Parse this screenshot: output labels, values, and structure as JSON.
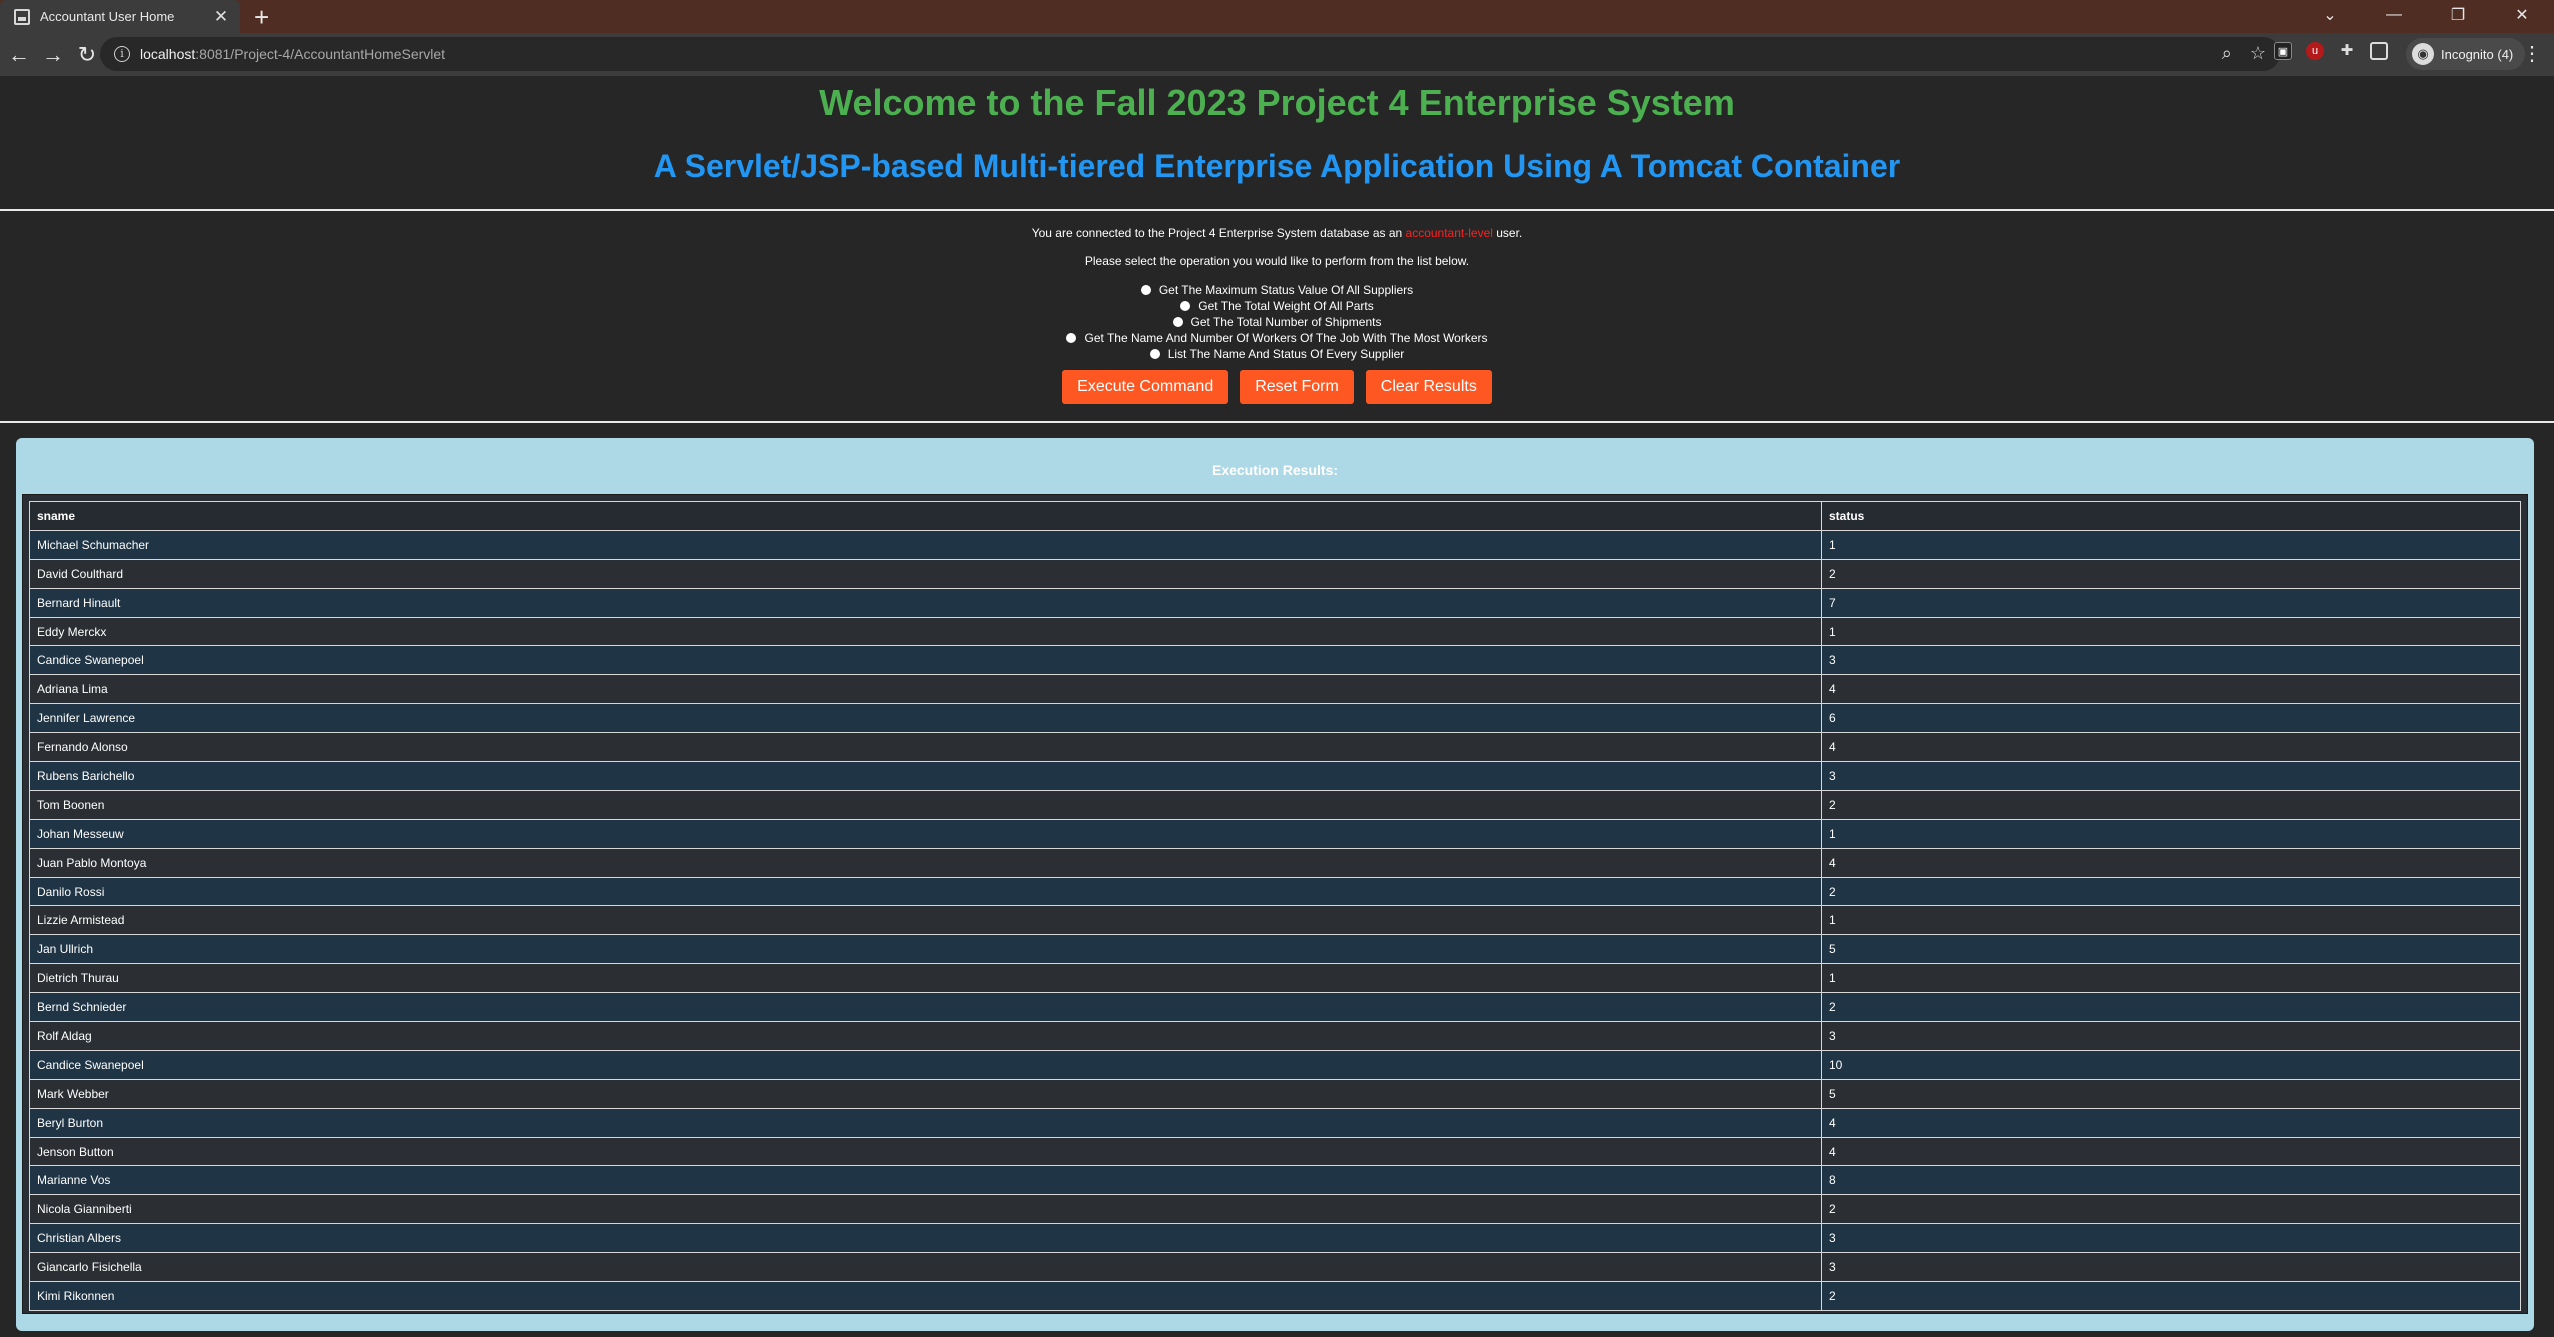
{
  "browser": {
    "tab_title": "Accountant User Home",
    "url_host": "localhost",
    "url_rest": ":8081/Project-4/AccountantHomeServlet",
    "profile_label": "Incognito (4)"
  },
  "page": {
    "title": "Welcome to the Fall 2023 Project 4 Enterprise System",
    "subtitle": "A Servlet/JSP-based Multi-tiered Enterprise Application Using A Tomcat Container",
    "connected_prefix": "You are connected to the Project 4 Enterprise System database as an ",
    "connected_level": "accountant-level",
    "connected_suffix": " user.",
    "instruction": "Please select the operation you would like to perform from the list below.",
    "options": [
      "Get The Maximum Status Value Of All Suppliers",
      "Get The Total Weight Of All Parts",
      "Get The Total Number of Shipments",
      "Get The Name And Number Of Workers Of The Job With The Most Workers",
      "List The Name And Status Of Every Supplier"
    ],
    "buttons": {
      "execute": "Execute Command",
      "reset": "Reset Form",
      "clear": "Clear Results"
    },
    "results_title": "Execution Results:"
  },
  "results": {
    "columns": [
      "sname",
      "status"
    ],
    "rows": [
      [
        "Michael Schumacher",
        "1"
      ],
      [
        "David Coulthard",
        "2"
      ],
      [
        "Bernard Hinault",
        "7"
      ],
      [
        "Eddy Merckx",
        "1"
      ],
      [
        "Candice Swanepoel",
        "3"
      ],
      [
        "Adriana Lima",
        "4"
      ],
      [
        "Jennifer Lawrence",
        "6"
      ],
      [
        "Fernando Alonso",
        "4"
      ],
      [
        "Rubens Barichello",
        "3"
      ],
      [
        "Tom Boonen",
        "2"
      ],
      [
        "Johan Messeuw",
        "1"
      ],
      [
        "Juan Pablo Montoya",
        "4"
      ],
      [
        "Danilo Rossi",
        "2"
      ],
      [
        "Lizzie Armistead",
        "1"
      ],
      [
        "Jan Ullrich",
        "5"
      ],
      [
        "Dietrich Thurau",
        "1"
      ],
      [
        "Bernd Schnieder",
        "2"
      ],
      [
        "Rolf Aldag",
        "3"
      ],
      [
        "Candice Swanepoel",
        "10"
      ],
      [
        "Mark Webber",
        "5"
      ],
      [
        "Beryl Burton",
        "4"
      ],
      [
        "Jenson Button",
        "4"
      ],
      [
        "Marianne Vos",
        "8"
      ],
      [
        "Nicola Gianniberti",
        "2"
      ],
      [
        "Christian Albers",
        "3"
      ],
      [
        "Giancarlo Fisichella",
        "3"
      ],
      [
        "Kimi Rikonnen",
        "2"
      ]
    ]
  },
  "colors": {
    "title": "#4caf50",
    "subtitle": "#2196f3",
    "button": "#ff5722",
    "level_text": "#ff2020",
    "results_panel": "#add8e6"
  }
}
